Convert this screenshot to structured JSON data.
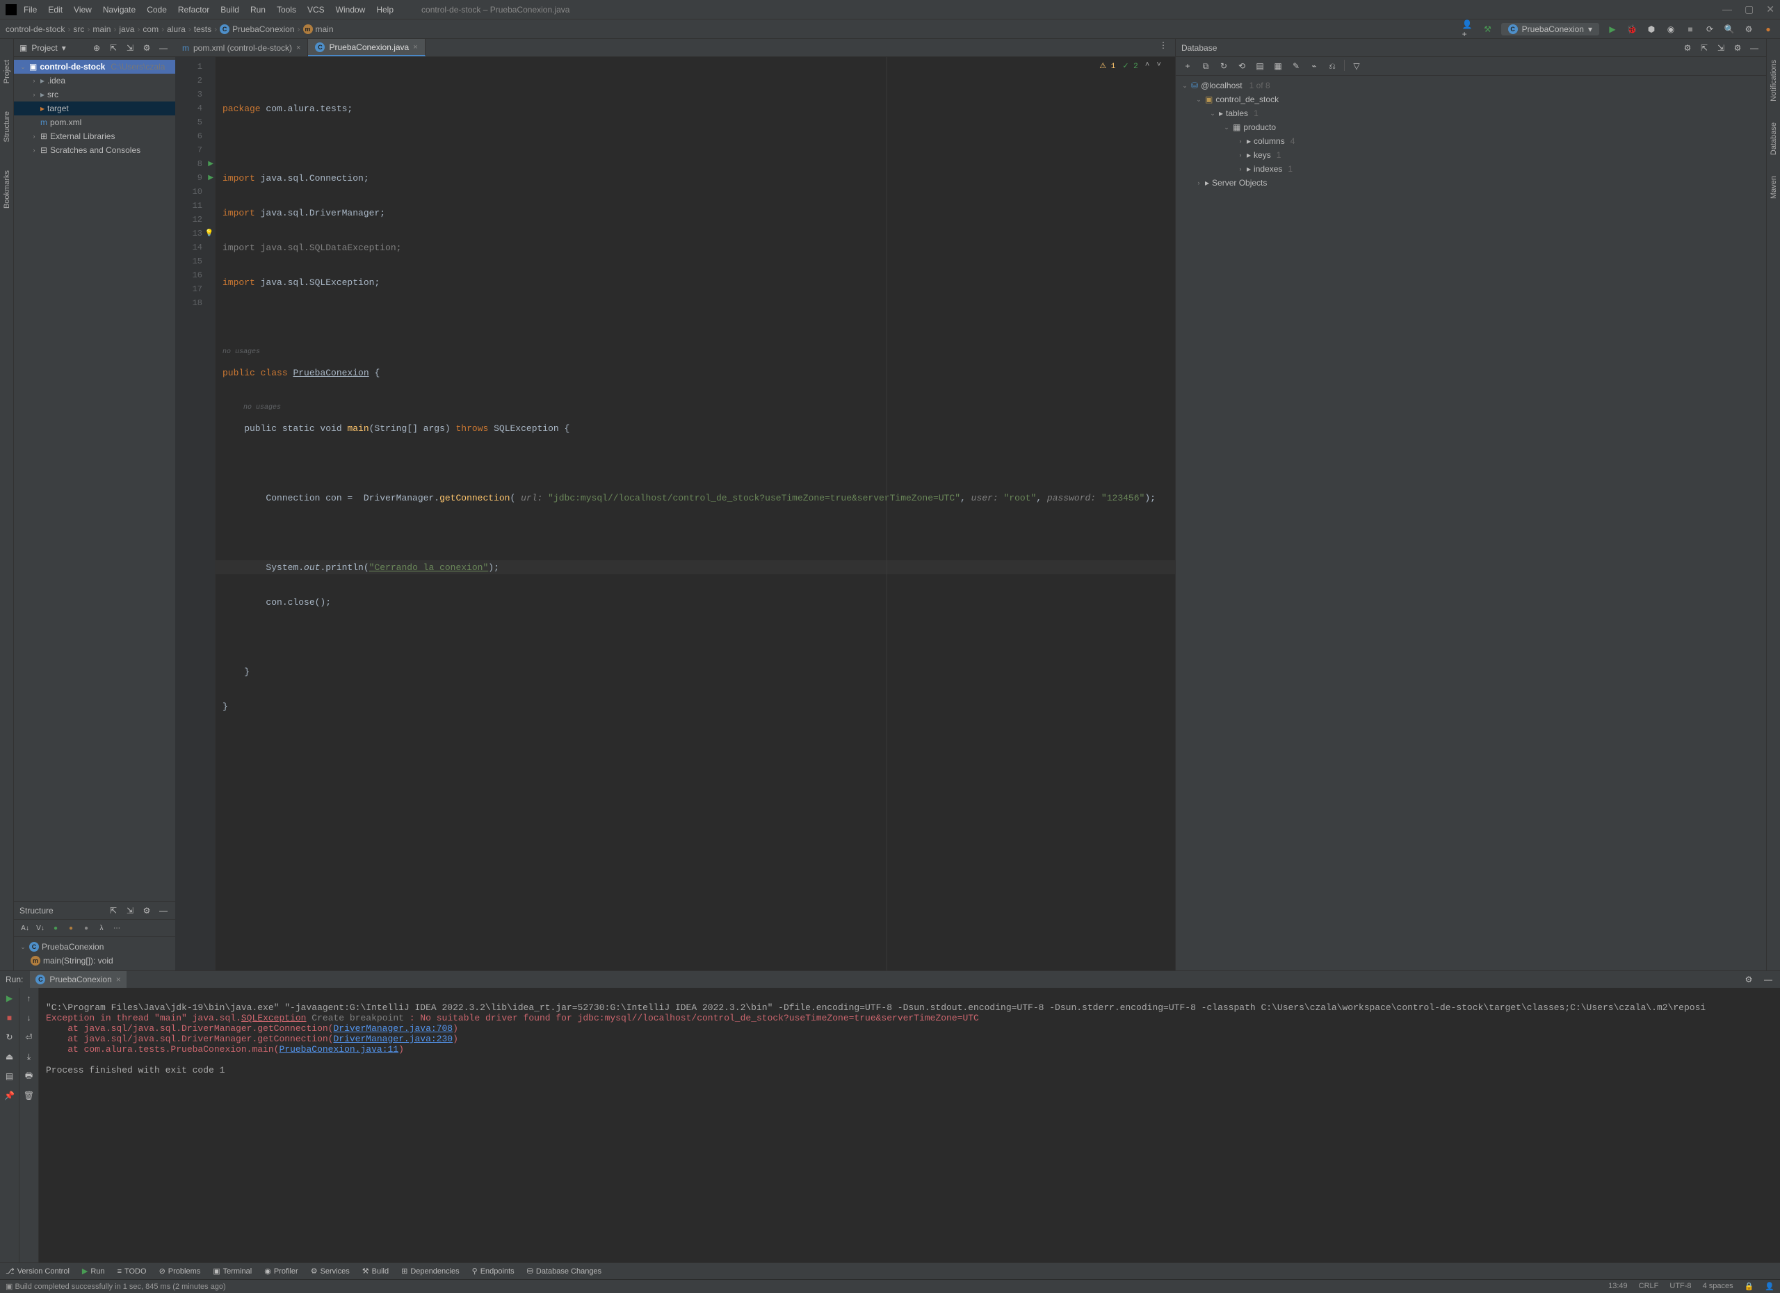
{
  "title": "control-de-stock – PruebaConexion.java",
  "menu": [
    "File",
    "Edit",
    "View",
    "Navigate",
    "Code",
    "Refactor",
    "Build",
    "Run",
    "Tools",
    "VCS",
    "Window",
    "Help"
  ],
  "breadcrumb": [
    "control-de-stock",
    "src",
    "main",
    "java",
    "com",
    "alura",
    "tests",
    "PruebaConexion",
    "main"
  ],
  "run_config": "PruebaConexion",
  "project_panel": {
    "title": "Project",
    "root": "control-de-stock",
    "root_meta": "C:\\Users\\czala",
    "items": [
      {
        "label": ".idea",
        "indent": 1,
        "chevron": "›",
        "icon": "folder"
      },
      {
        "label": "src",
        "indent": 1,
        "chevron": "›",
        "icon": "folder"
      },
      {
        "label": "target",
        "indent": 1,
        "chevron": "",
        "icon": "folder-orange",
        "highlighted": true
      },
      {
        "label": "pom.xml",
        "indent": 1,
        "chevron": "",
        "icon": "file-m"
      },
      {
        "label": "External Libraries",
        "indent": 0,
        "chevron": "›",
        "icon": "lib"
      },
      {
        "label": "Scratches and Consoles",
        "indent": 0,
        "chevron": "›",
        "icon": "scratch"
      }
    ]
  },
  "structure_panel": {
    "title": "Structure",
    "class": "PruebaConexion",
    "method": "main(String[]): void"
  },
  "editor_tabs": [
    {
      "label": "pom.xml (control-de-stock)",
      "icon": "m",
      "active": false
    },
    {
      "label": "PruebaConexion.java",
      "icon": "c",
      "active": true
    }
  ],
  "inspection": {
    "warn": "1",
    "check": "2"
  },
  "code": {
    "l1": "package com.alura.tests;",
    "l3": "import java.sql.Connection;",
    "l4": "import java.sql.DriverManager;",
    "l5": "import java.sql.SQLDataException;",
    "l6": "import java.sql.SQLException;",
    "hint8": "no usages",
    "l8": "public class PruebaConexion {",
    "hint9": "no usages",
    "l9_pre": "    public static void ",
    "l9_name": "main",
    "l9_args": "(String[] args) ",
    "l9_throws": "throws",
    "l9_exc": " SQLException {",
    "l11_a": "        Connection con =  DriverManager.",
    "l11_b": "getConnection",
    "l11_p1": "url:",
    "l11_s1": "\"jdbc:mysql//localhost/control_de_stock?useTimeZone=true&serverTimeZone=UTC\"",
    "l11_p2": "user:",
    "l11_s2": "\"root\"",
    "l11_p3": "password:",
    "l11_s3": "\"123456\"",
    "l13_a": "        System.",
    "l13_b": "out",
    "l13_c": ".println(",
    "l13_s": "\"Cerrando la conexion\"",
    "l13_e": ");",
    "l14": "        con.close();",
    "l16": "    }",
    "l17": "}"
  },
  "database_panel": {
    "title": "Database",
    "root": "@localhost",
    "root_meta": "1 of 8",
    "items": [
      {
        "label": "control_de_stock",
        "indent": 1,
        "chevron": "⌄"
      },
      {
        "label": "tables",
        "indent": 2,
        "chevron": "⌄",
        "meta": "1"
      },
      {
        "label": "producto",
        "indent": 3,
        "chevron": "⌄"
      },
      {
        "label": "columns",
        "indent": 4,
        "chevron": "›",
        "meta": "4"
      },
      {
        "label": "keys",
        "indent": 4,
        "chevron": "›",
        "meta": "1"
      },
      {
        "label": "indexes",
        "indent": 4,
        "chevron": "›",
        "meta": "1"
      },
      {
        "label": "Server Objects",
        "indent": 1,
        "chevron": "›"
      }
    ]
  },
  "run_panel": {
    "title": "Run:",
    "tab": "PruebaConexion",
    "line1": "\"C:\\Program Files\\Java\\jdk-19\\bin\\java.exe\" \"-javaagent:G:\\IntelliJ IDEA 2022.3.2\\lib\\idea_rt.jar=52730:G:\\IntelliJ IDEA 2022.3.2\\bin\" -Dfile.encoding=UTF-8 -Dsun.stdout.encoding=UTF-8 -Dsun.stderr.encoding=UTF-8 -classpath C:\\Users\\czala\\workspace\\control-de-stock\\target\\classes;C:\\Users\\czala\\.m2\\reposi",
    "line2a": "Exception in thread \"main\" java.sql.",
    "line2b": "SQLException",
    "line2c": "Create breakpoint",
    "line2d": " : No suitable driver found for jdbc:mysql//localhost/control_de_stock?useTimeZone=true&serverTimeZone=UTC",
    "line3a": "    at java.sql/java.sql.DriverManager.getConnection(",
    "line3b": "DriverManager.java:708",
    "line4a": "    at java.sql/java.sql.DriverManager.getConnection(",
    "line4b": "DriverManager.java:230",
    "line5a": "    at com.alura.tests.PruebaConexion.main(",
    "line5b": "PruebaConexion.java:11",
    "line7": "Process finished with exit code 1"
  },
  "bottom_bar": [
    "Version Control",
    "Run",
    "TODO",
    "Problems",
    "Terminal",
    "Profiler",
    "Services",
    "Build",
    "Dependencies",
    "Endpoints",
    "Database Changes"
  ],
  "status": {
    "left": "Build completed successfully in 1 sec, 845 ms (2 minutes ago)",
    "pos": "13:49",
    "crlf": "CRLF",
    "enc": "UTF-8",
    "indent": "4 spaces"
  }
}
